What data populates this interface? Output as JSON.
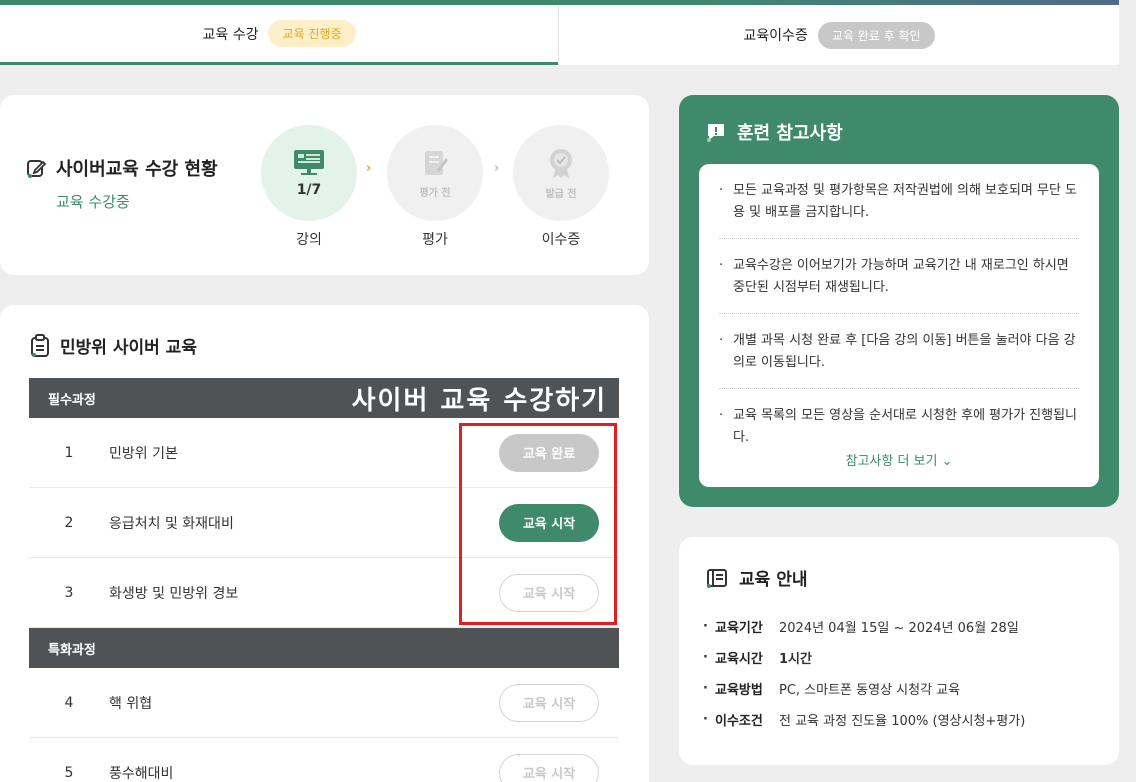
{
  "tabs": [
    {
      "label": "교육 수강",
      "badge": "교육 진행중"
    },
    {
      "label": "교육이수증",
      "badge": "교육 완료 후 확인"
    }
  ],
  "status": {
    "title": "사이버교육 수강 현황",
    "subtitle": "교육 수강중",
    "steps": [
      {
        "circle_text": "1/7",
        "label": "강의"
      },
      {
        "circle_text": "평가 전",
        "label": "평가"
      },
      {
        "circle_text": "발급 전",
        "label": "이수증"
      }
    ],
    "arrow": "›"
  },
  "courses": {
    "title": "민방위 사이버 교육",
    "overlay": "사이버 교육 수강하기",
    "required_label": "필수과정",
    "special_label": "특화과정",
    "required": [
      {
        "num": "1",
        "name": "민방위 기본",
        "button": "교육 완료"
      },
      {
        "num": "2",
        "name": "응급처치 및 화재대비",
        "button": "교육 시작"
      },
      {
        "num": "3",
        "name": "화생방 및 민방위 경보",
        "button": "교육 시작"
      }
    ],
    "special": [
      {
        "num": "4",
        "name": "핵 위협",
        "button": "교육 시작"
      },
      {
        "num": "5",
        "name": "풍수해대비",
        "button": "교육 시작"
      }
    ]
  },
  "notice": {
    "title": "훈련 참고사항",
    "items": [
      "모든 교육과정 및 평가항목은 저작권법에 의해 보호되며 무단 도용 및 배포를 금지합니다.",
      "교육수강은 이어보기가 가능하며 교육기간 내 재로그인 하시면 중단된 시점부터 재생됩니다.",
      "개별 과목 시청 완료 후 [다음 강의 이동] 버튼을 눌러야 다음 강의로 이동됩니다.",
      "교육 목록의 모든 영상을 순서대로 시청한 후에 평가가 진행됩니다."
    ],
    "more": "참고사항 더 보기 ⌄"
  },
  "guide": {
    "title": "교육 안내",
    "items": [
      {
        "label": "교육기간",
        "value": "2024년 04월 15일 ~ 2024년 06월 28일"
      },
      {
        "label": "교육시간",
        "value": "1시간"
      },
      {
        "label": "교육방법",
        "value": "PC, 스마트폰 동영상 시청각 교육"
      },
      {
        "label": "이수조건",
        "value": "전 교육 과정 진도율 100% (영상시청+평가)"
      }
    ]
  },
  "colors": {
    "accent": "#3e8a6b",
    "header_dark": "#4f5356",
    "badge_yellow": "#e8a41c",
    "highlight": "#e02020"
  }
}
